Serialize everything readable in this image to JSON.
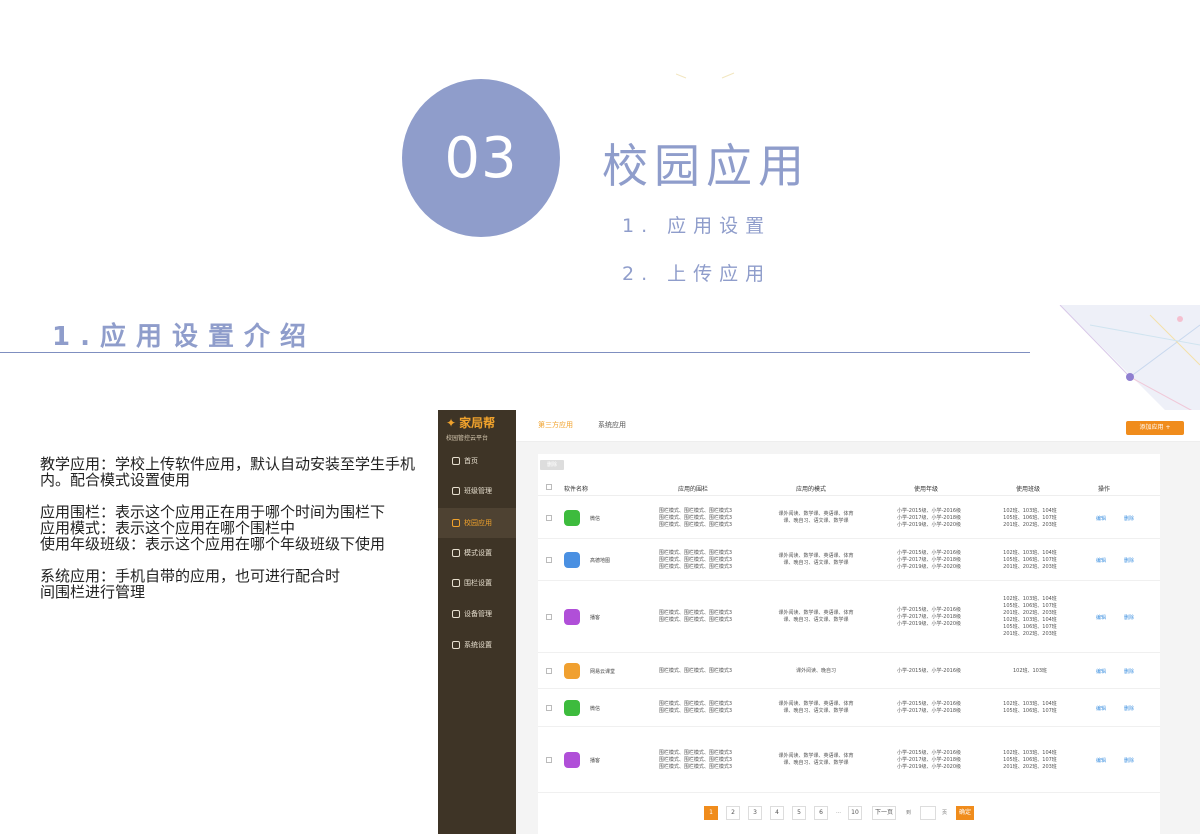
{
  "slide": {
    "number": "03",
    "title": "校园应用",
    "toc": [
      "1. 应用设置",
      "2. 上传应用"
    ],
    "section_title": "1.应用设置介绍",
    "accent_color": "#8f9dcb"
  },
  "description": [
    "教学应用：学校上传软件应用，默认自动安装至学生手机内。配合模式设置使用",
    "应用围栏：表示这个应用正在用于哪个时间为围栏下\n应用模式：表示这个应用在哪个围栏中\n使用年级班级：表示这个应用在哪个年级班级下使用",
    "系统应用：手机自带的应用，也可进行配合时\n间围栏进行管理"
  ],
  "app": {
    "brand": "家局帮",
    "subtitle": "校园管控云平台",
    "nav": [
      "首页",
      "班级管理",
      "校园应用",
      "模式设置",
      "围栏设置",
      "设备管理",
      "系统设置"
    ],
    "active_nav": 2,
    "tabs": [
      "第三方应用",
      "系统应用"
    ],
    "add_button": "添加应用 +",
    "delete_button": "删除",
    "columns": [
      "软件名称",
      "应用的围栏",
      "应用的模式",
      "使用年级",
      "使用班级",
      "操作"
    ],
    "rows": [
      {
        "name": "微信",
        "icon": "wechat-icon",
        "color": "#3dbb3d",
        "fence": "围栏模式、围栏模式、围栏模式3\n围栏模式、围栏模式、围栏模式3\n围栏模式、围栏模式、围栏模式3",
        "mode": "课外阅读、数学课、英语课、体育\n课、晚自习、语文课、数学课",
        "grade": "小学-2015级、小学-2016级\n小学-2017级、小学-2018级\n小学-2019级、小学-2020级",
        "class": "102班、103班、104班\n105班、106班、107班\n201班、202班、203班"
      },
      {
        "name": "高德地图",
        "icon": "map-icon",
        "color": "#4a90e2",
        "fence": "围栏模式、围栏模式、围栏模式3\n围栏模式、围栏模式、围栏模式3\n围栏模式、围栏模式、围栏模式3",
        "mode": "课外阅读、数学课、英语课、体育\n课、晚自习、语文课、数学课",
        "grade": "小学-2015级、小学-2016级\n小学-2017级、小学-2018级\n小学-2019级、小学-2020级",
        "class": "102班、103班、104班\n105班、106班、107班\n201班、202班、203班"
      },
      {
        "name": "播客",
        "icon": "podcast-icon",
        "color": "#b04fd8",
        "fence": "围栏模式、围栏模式、围栏模式3\n围栏模式、围栏模式、围栏模式3",
        "mode": "课外阅读、数学课、英语课、体育\n课、晚自习、语文课、数学课",
        "grade": "小学-2015级、小学-2016级\n小学-2017级、小学-2018级\n小学-2019级、小学-2020级",
        "class": "102班、103班、104班\n105班、106班、107班\n201班、202班、203班\n102班、103班、104班\n105班、106班、107班\n201班、202班、203班"
      },
      {
        "name": "网易云课堂",
        "icon": "book-icon",
        "color": "#f0a030",
        "fence": "围栏模式、围栏模式、围栏模式3",
        "mode": "课外阅读、晚自习",
        "grade": "小学-2015级、小学-2016级",
        "class": "102班、103班"
      },
      {
        "name": "微信",
        "icon": "wechat-icon",
        "color": "#3dbb3d",
        "fence": "围栏模式、围栏模式、围栏模式3\n围栏模式、围栏模式、围栏模式3",
        "mode": "课外阅读、数学课、英语课、体育\n课、晚自习、语文课、数学课",
        "grade": "小学-2015级、小学-2016级\n小学-2017级、小学-2018级",
        "class": "102班、103班、104班\n105班、106班、107班"
      },
      {
        "name": "播客",
        "icon": "podcast-icon",
        "color": "#b04fd8",
        "fence": "围栏模式、围栏模式、围栏模式3\n围栏模式、围栏模式、围栏模式3\n围栏模式、围栏模式、围栏模式3",
        "mode": "课外阅读、数学课、英语课、体育\n课、晚自习、语文课、数学课",
        "grade": "小学-2015级、小学-2016级\n小学-2017级、小学-2018级\n小学-2019级、小学-2020级",
        "class": "102班、103班、104班\n105班、106班、107班\n201班、202班、203班"
      }
    ],
    "op_edit": "编辑",
    "op_delete": "删除",
    "pager": {
      "pages": [
        "1",
        "2",
        "3",
        "4",
        "5",
        "6",
        "…",
        "10"
      ],
      "next": "下一页",
      "goto_prefix": "到",
      "goto_suffix": "页",
      "confirm": "确定"
    }
  }
}
